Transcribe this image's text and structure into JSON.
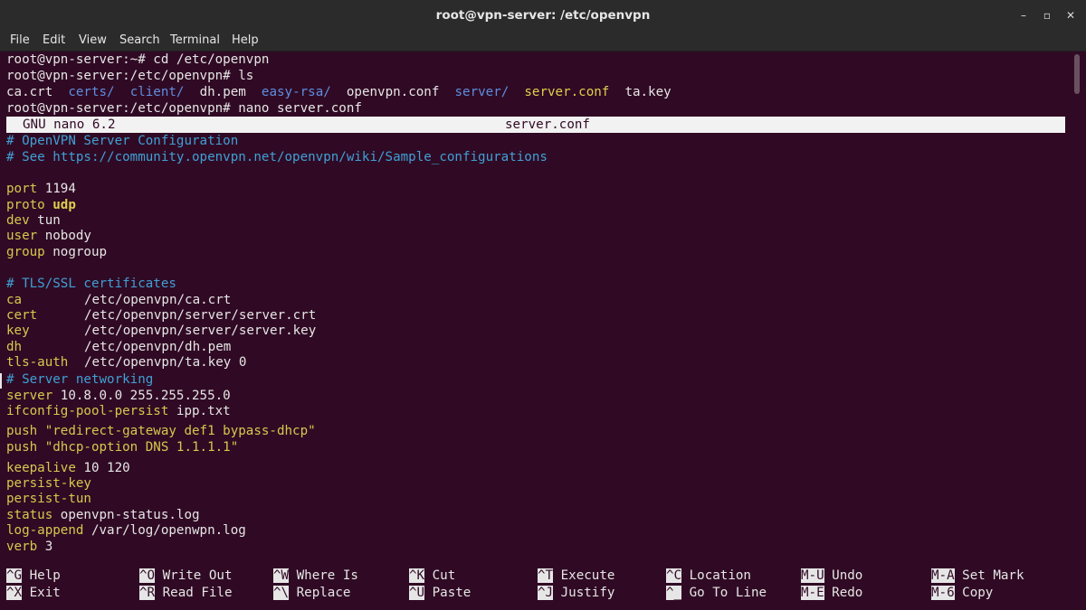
{
  "window": {
    "title": "root@vpn-server: /etc/openvpn",
    "minimize_glyph": "–",
    "maximize_glyph": "▫",
    "close_glyph": "✕"
  },
  "menu": [
    "File",
    "Edit",
    "View",
    "Search",
    "Terminal",
    "Help"
  ],
  "shell": {
    "line1": "root@vpn-server:~# cd /etc/openvpn",
    "line2": "root@vpn-server:/etc/openvpn# ls",
    "ls": [
      {
        "name": "ca.crt",
        "kind": "file"
      },
      {
        "name": "certs/",
        "kind": "dir"
      },
      {
        "name": "client/",
        "kind": "dir"
      },
      {
        "name": "dh.pem",
        "kind": "file"
      },
      {
        "name": "easy-rsa/",
        "kind": "dir"
      },
      {
        "name": "openvpn.conf",
        "kind": "file"
      },
      {
        "name": "server/",
        "kind": "dir"
      },
      {
        "name": "server.conf",
        "kind": "highlight"
      },
      {
        "name": "ta.key",
        "kind": "file"
      }
    ],
    "line4": "root@vpn-server:/etc/openvpn# nano server.conf"
  },
  "nano": {
    "version": "GNU nano 6.2",
    "filename": "server.conf"
  },
  "file": {
    "c1": "# OpenVPN Server Configuration",
    "c2": "# See https://community.openvpn.net/openvpn/wiki/Sample_configurations",
    "port_k": "port",
    "port_v": " 1194",
    "proto_k": "proto",
    "proto_v": "udp",
    "dev_k": "dev",
    "dev_v": " tun",
    "user_k": "user",
    "user_v": " nobody",
    "group_k": "group",
    "group_v": " nogroup",
    "c3": "# TLS/SSL certificates",
    "ca_k": "ca",
    "ca_v": "/etc/openvpn/ca.crt",
    "cert_k": "cert",
    "cert_v": "/etc/openvpn/server/server.crt",
    "key_k": "key",
    "key_v": "/etc/openvpn/server/server.key",
    "dh_k": "dh",
    "dh_v": "/etc/openvpn/dh.pem",
    "tls_k": "tls-auth",
    "tls_v": "/etc/openvpn/ta.key 0",
    "c4": "# Server networking",
    "server_k": "server",
    "server_v": " 10.8.0.0 255.255.255.0",
    "ifc_k": "ifconfig-pool-persist",
    "ifc_v": " ipp.txt",
    "push1_k": "push",
    "push1_v": " \"redirect-gateway def1 bypass-dhcp\"",
    "push2_k": "push",
    "push2_v": " \"dhcp-option DNS 1.1.1.1\"",
    "keep_k": "keepalive",
    "keep_v": " 10 120",
    "pkey": "persist-key",
    "ptun": "persist-tun",
    "status_k": "status",
    "status_v": " openvpn-status.log",
    "log_k": "log-append",
    "log_v": " /var/log/openwpn.log",
    "verb_k": "verb",
    "verb_v": " 3"
  },
  "shortcuts": [
    {
      "key": "^G",
      "label": "Help"
    },
    {
      "key": "^O",
      "label": "Write Out"
    },
    {
      "key": "^W",
      "label": "Where Is"
    },
    {
      "key": "^K",
      "label": "Cut"
    },
    {
      "key": "^T",
      "label": "Execute"
    },
    {
      "key": "^C",
      "label": "Location"
    },
    {
      "key": "M-U",
      "label": "Undo"
    },
    {
      "key": "M-A",
      "label": "Set Mark"
    },
    {
      "key": "^X",
      "label": "Exit"
    },
    {
      "key": "^R",
      "label": "Read File"
    },
    {
      "key": "^\\",
      "label": "Replace"
    },
    {
      "key": "^U",
      "label": "Paste"
    },
    {
      "key": "^J",
      "label": "Justify"
    },
    {
      "key": "^_",
      "label": "Go To Line"
    },
    {
      "key": "M-E",
      "label": "Redo"
    },
    {
      "key": "M-6",
      "label": "Copy"
    }
  ]
}
